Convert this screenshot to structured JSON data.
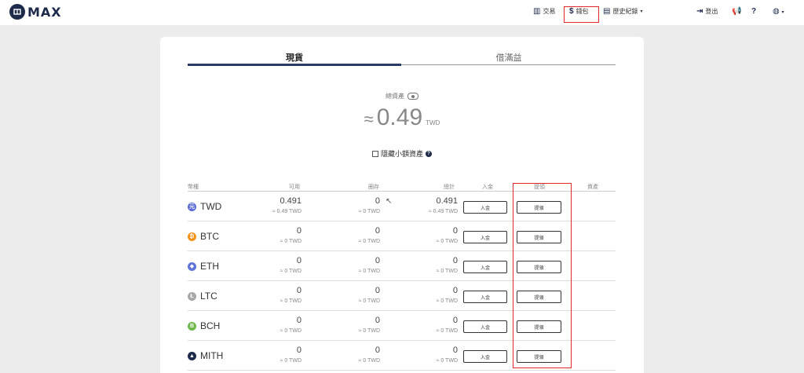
{
  "brand": {
    "name": "MAX"
  },
  "nav": {
    "trade": "交易",
    "wallet": "錢包",
    "history": "歷史紀錄",
    "logout": "登出"
  },
  "tabs": {
    "spot": "現貨",
    "margin": "借滿益"
  },
  "summary": {
    "label": "總資產",
    "approx": "≈",
    "amount": "0.49",
    "unit": "TWD",
    "hide_small": "隱藏小額資產"
  },
  "table": {
    "headers": [
      "幣種",
      "可用",
      "圈存",
      "總計",
      "入金",
      "提領",
      "資產"
    ],
    "deposit_label": "入金",
    "withdraw_label": "提領",
    "rows": [
      {
        "coin": "TWD",
        "available": "0.491",
        "available_sub": "≈ 0.49 TWD",
        "locked": "0",
        "locked_sub": "≈ 0 TWD",
        "total": "0.491",
        "total_sub": "≈ 0.49 TWD",
        "icon": "元",
        "color": "#5b6bd6"
      },
      {
        "coin": "BTC",
        "available": "0",
        "available_sub": "≈ 0 TWD",
        "locked": "0",
        "locked_sub": "≈ 0 TWD",
        "total": "0",
        "total_sub": "≈ 0 TWD",
        "icon": "₿",
        "color": "#f7931a"
      },
      {
        "coin": "ETH",
        "available": "0",
        "available_sub": "≈ 0 TWD",
        "locked": "0",
        "locked_sub": "≈ 0 TWD",
        "total": "0",
        "total_sub": "≈ 0 TWD",
        "icon": "◆",
        "color": "#5f73d9"
      },
      {
        "coin": "LTC",
        "available": "0",
        "available_sub": "≈ 0 TWD",
        "locked": "0",
        "locked_sub": "≈ 0 TWD",
        "total": "0",
        "total_sub": "≈ 0 TWD",
        "icon": "Ł",
        "color": "#a8a8a8"
      },
      {
        "coin": "BCH",
        "available": "0",
        "available_sub": "≈ 0 TWD",
        "locked": "0",
        "locked_sub": "≈ 0 TWD",
        "total": "0",
        "total_sub": "≈ 0 TWD",
        "icon": "B",
        "color": "#6fb74a"
      },
      {
        "coin": "MITH",
        "available": "0",
        "available_sub": "≈ 0 TWD",
        "locked": "0",
        "locked_sub": "≈ 0 TWD",
        "total": "0",
        "total_sub": "≈ 0 TWD",
        "icon": "▲",
        "color": "#1e2a4a"
      }
    ]
  }
}
